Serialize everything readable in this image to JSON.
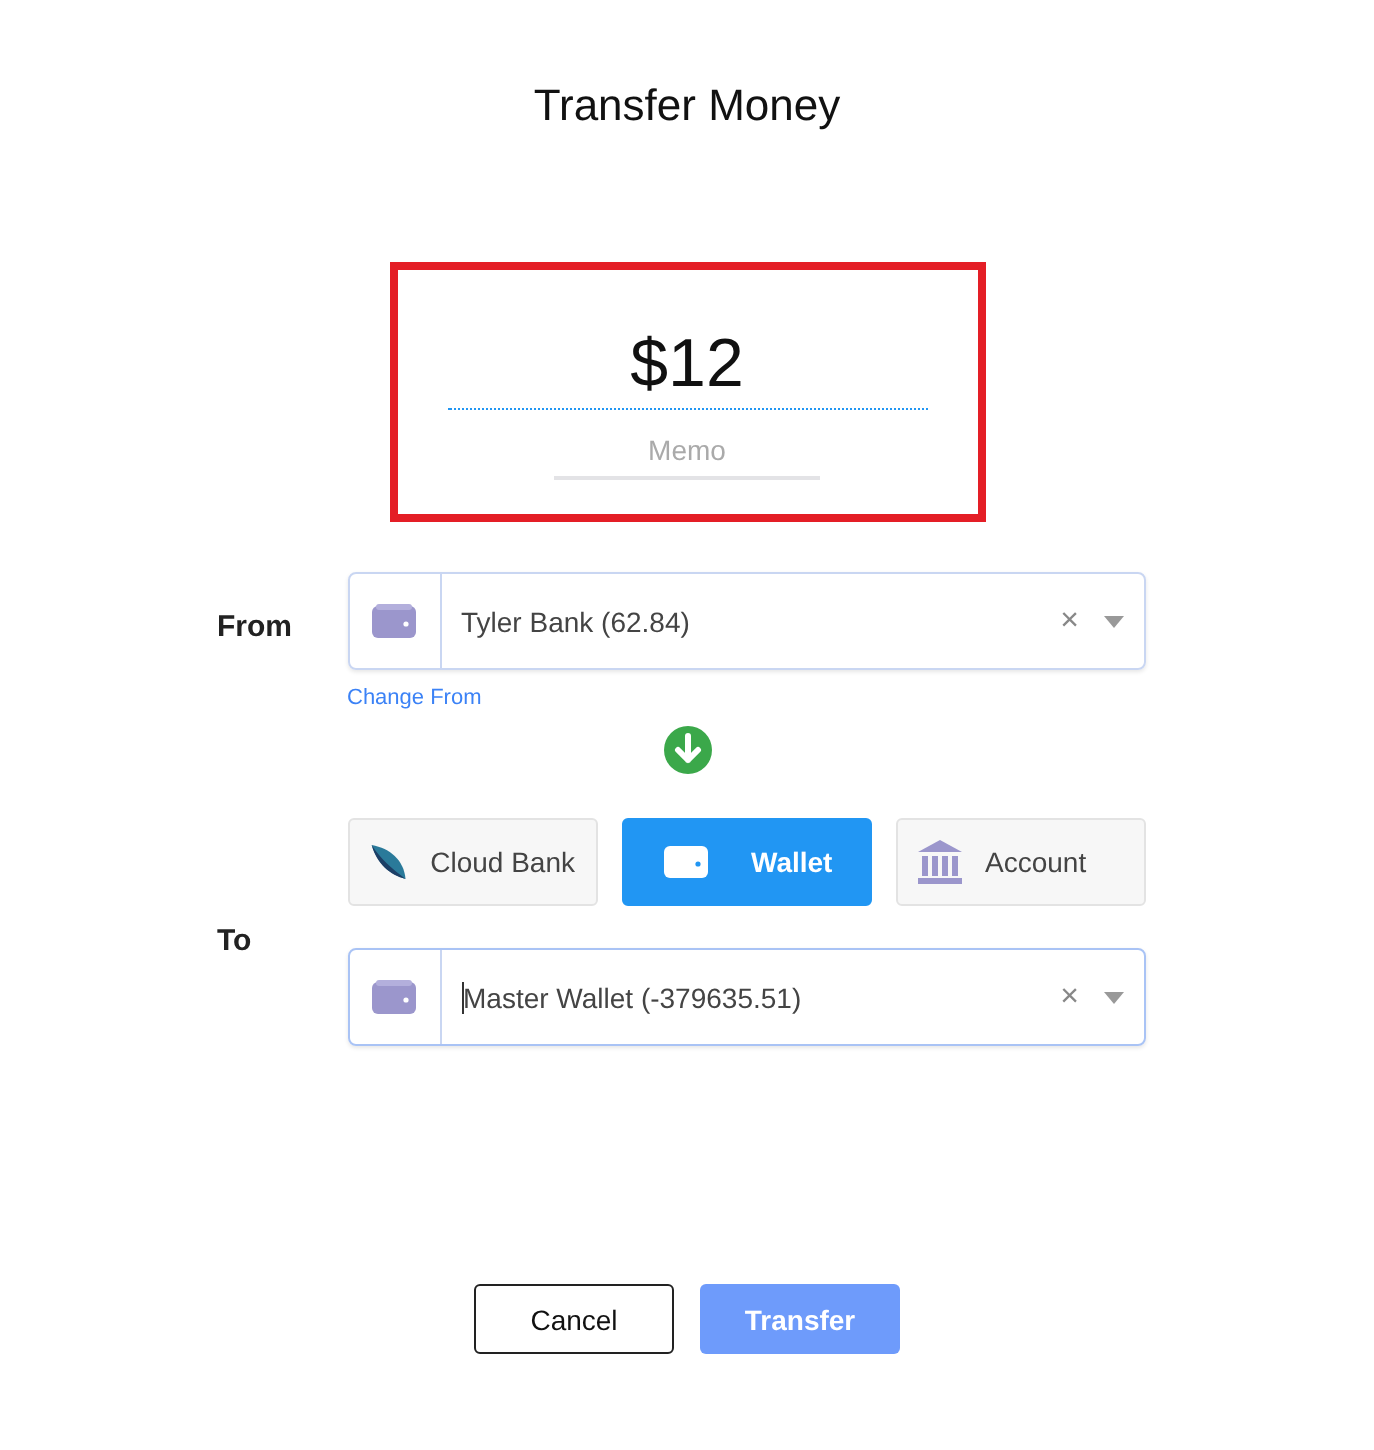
{
  "title": "Transfer Money",
  "amount": {
    "value": "$12",
    "memo_placeholder": "Memo",
    "highlighted": true
  },
  "from": {
    "label": "From",
    "value": "Tyler Bank (62.84)",
    "clear": "×",
    "link": "Change From"
  },
  "to": {
    "label": "To",
    "options": [
      {
        "kind": "cloud",
        "label": "Cloud Bank",
        "selected": false
      },
      {
        "kind": "wallet",
        "label": "Wallet",
        "selected": true
      },
      {
        "kind": "bank",
        "label": "Account",
        "selected": false
      }
    ],
    "value": "Master Wallet (-379635.51)",
    "clear": "×",
    "focused": true
  },
  "buttons": [
    {
      "kind": "cancel",
      "label": "Cancel",
      "disabled": false
    },
    {
      "kind": "primary",
      "label": "Transfer",
      "disabled": true
    }
  ]
}
